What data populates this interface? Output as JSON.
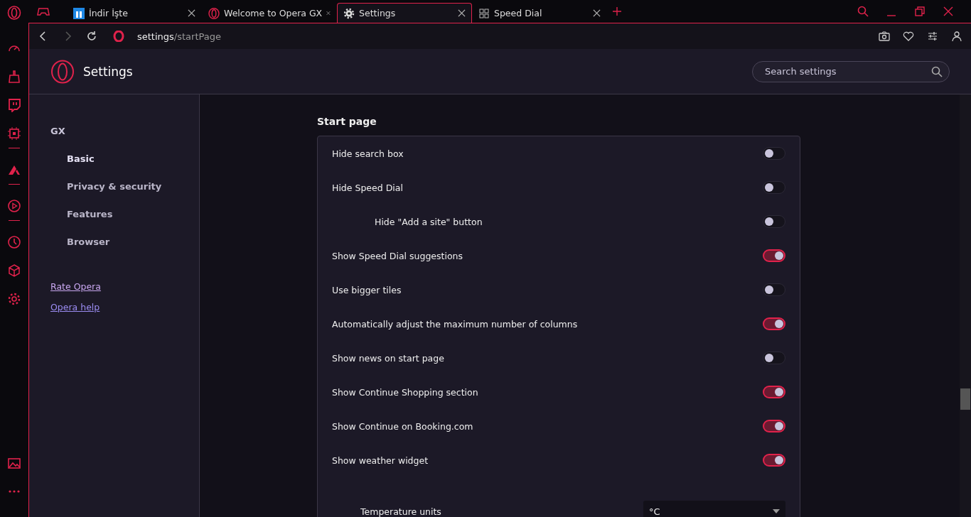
{
  "tabs": [
    {
      "label": "İndir İşte",
      "kind": "app",
      "selected": false
    },
    {
      "label": "Welcome to Opera GX",
      "kind": "opera",
      "selected": false
    },
    {
      "label": "Settings",
      "kind": "gear",
      "selected": true
    },
    {
      "label": "Speed Dial",
      "kind": "grid",
      "selected": false
    }
  ],
  "address": {
    "host": "settings",
    "path": "/startPage"
  },
  "header": {
    "title": "Settings",
    "search": {
      "placeholder": "Search settings"
    }
  },
  "nav": {
    "section": "GX",
    "items": [
      {
        "label": "Basic",
        "selected": true
      },
      {
        "label": "Privacy & security",
        "selected": false
      },
      {
        "label": "Features",
        "selected": false
      },
      {
        "label": "Browser",
        "selected": false
      }
    ],
    "links": [
      "Rate Opera",
      "Opera help"
    ]
  },
  "section_title": "Start page",
  "settings": [
    {
      "kind": "toggle",
      "label": "Hide search box",
      "on": false
    },
    {
      "kind": "toggle",
      "label": "Hide Speed Dial",
      "on": false,
      "children": [
        {
          "kind": "toggle",
          "label": "Hide \"Add a site\" button",
          "on": false
        }
      ]
    },
    {
      "kind": "toggle",
      "label": "Show Speed Dial suggestions",
      "on": true
    },
    {
      "kind": "toggle",
      "label": "Use bigger tiles",
      "on": false
    },
    {
      "kind": "toggle",
      "label": "Automatically adjust the maximum number of columns",
      "on": true
    },
    {
      "kind": "toggle",
      "label": "Show news on start page",
      "on": false
    },
    {
      "kind": "toggle",
      "label": "Show Continue Shopping section",
      "on": true
    },
    {
      "kind": "toggle",
      "label": "Show Continue on Booking.com",
      "on": true
    },
    {
      "kind": "toggle",
      "label": "Show weather widget",
      "on": true,
      "children": [
        {
          "kind": "select",
          "label": "Temperature units",
          "value": "°C"
        }
      ]
    }
  ]
}
